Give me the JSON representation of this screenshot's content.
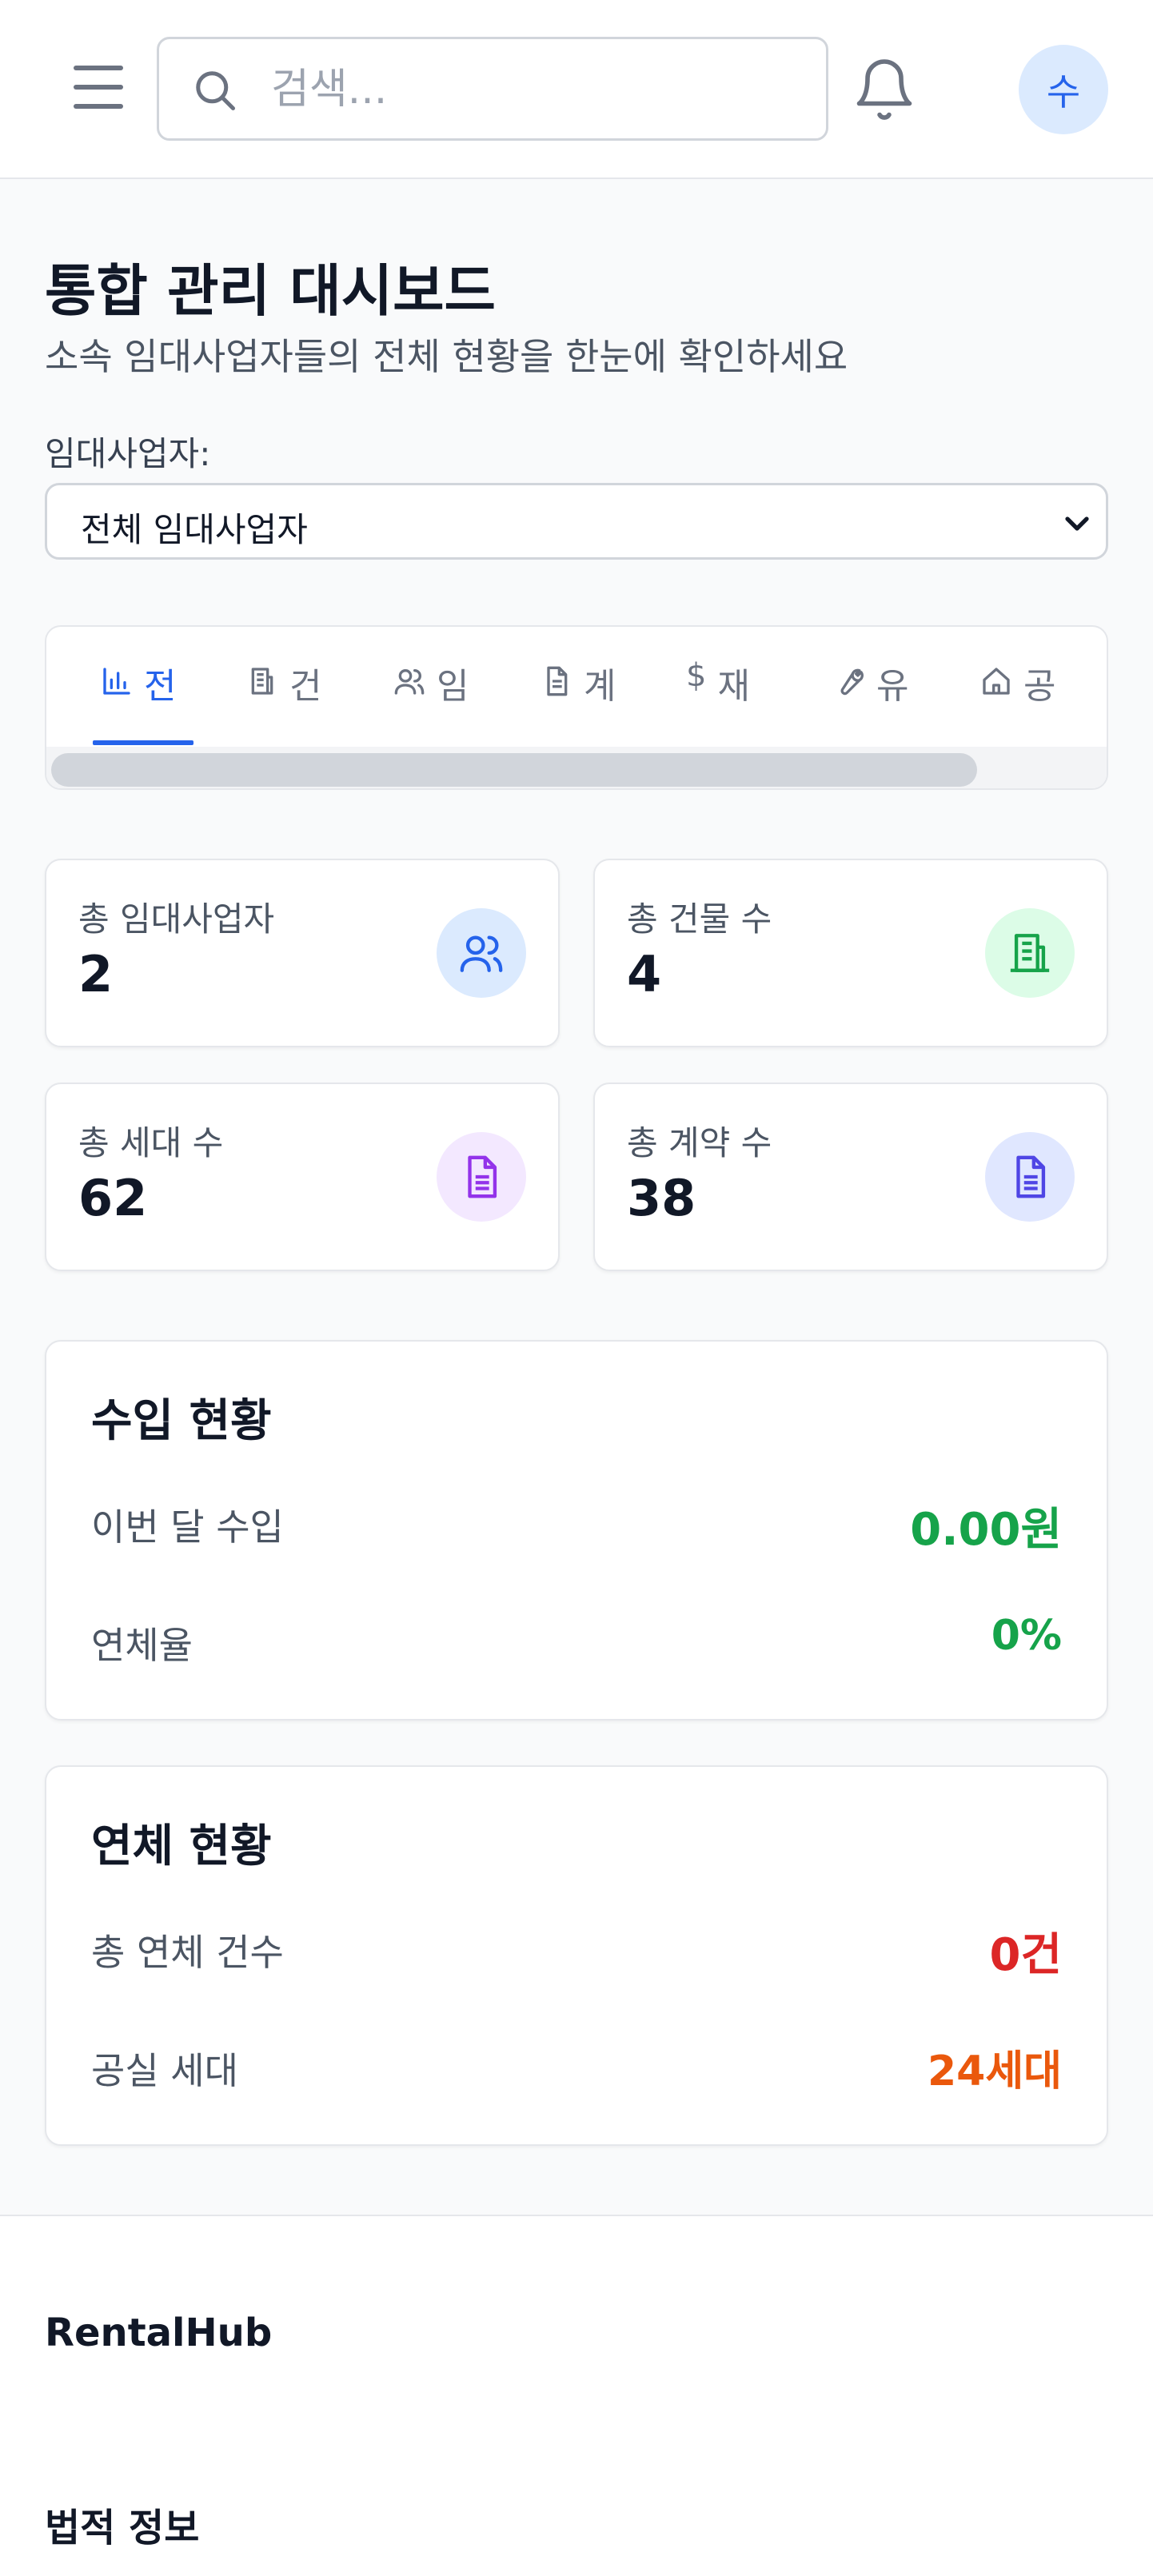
{
  "header": {
    "search_placeholder": "검색...",
    "avatar_initial": "수"
  },
  "page": {
    "title": "통합 관리 대시보드",
    "subtitle": "소속 임대사업자들의 전체 현황을 한눈에 확인하세요",
    "filter_label": "임대사업자:",
    "filter_selected": "전체 임대사업자"
  },
  "tabs": [
    {
      "label": "전",
      "icon": "bar-chart-icon",
      "active": true
    },
    {
      "label": "건",
      "icon": "building-icon",
      "active": false
    },
    {
      "label": "임",
      "icon": "users-icon",
      "active": false
    },
    {
      "label": "계",
      "icon": "document-icon",
      "active": false
    },
    {
      "label": "재",
      "icon": "dollar-icon",
      "active": false
    },
    {
      "label": "유",
      "icon": "wrench-icon",
      "active": false
    },
    {
      "label": "공",
      "icon": "home-icon",
      "active": false
    }
  ],
  "stats": [
    {
      "label": "총 임대사업자",
      "value": "2",
      "icon": "users-icon",
      "color": "#2563eb",
      "bg": "#dbeafe"
    },
    {
      "label": "총 건물 수",
      "value": "4",
      "icon": "building-icon",
      "color": "#16a34a",
      "bg": "#dcfce7"
    },
    {
      "label": "총 세대 수",
      "value": "62",
      "icon": "document-icon",
      "color": "#9333ea",
      "bg": "#f3e8ff"
    },
    {
      "label": "총 계약 수",
      "value": "38",
      "icon": "document-icon",
      "color": "#4f46e5",
      "bg": "#e0e7ff"
    }
  ],
  "income": {
    "title": "수입 현황",
    "rows": [
      {
        "label": "이번 달 수입",
        "value": "0.00원",
        "color": "#16a34a"
      },
      {
        "label": "연체율",
        "value": "0%",
        "color": "#16a34a"
      }
    ]
  },
  "overdue": {
    "title": "연체 현황",
    "rows": [
      {
        "label": "총 연체 건수",
        "value": "0건",
        "color": "#dc2626"
      },
      {
        "label": "공실 세대",
        "value": "24세대",
        "color": "#ea580c"
      }
    ]
  },
  "footer": {
    "brand": "RentalHub",
    "legal_heading": "법적 정보"
  }
}
